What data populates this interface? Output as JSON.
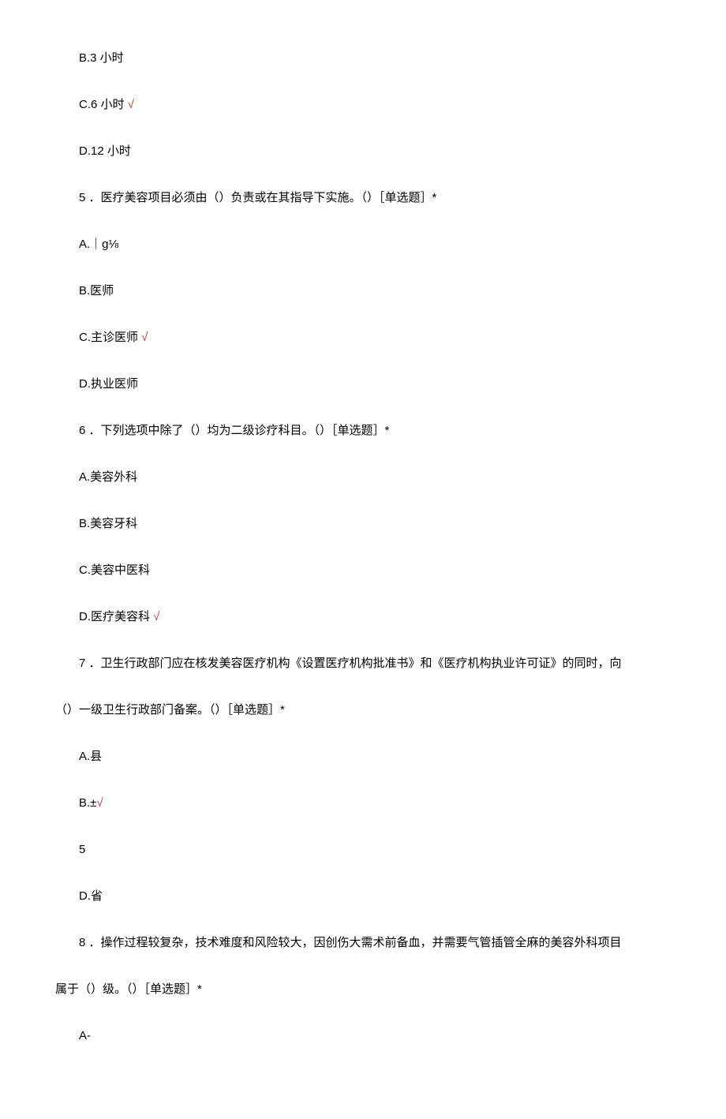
{
  "lines": {
    "l1": "B.3 小时",
    "l2": "C.6 小时 ",
    "l2_check": "√",
    "l3": "D.12 小时",
    "q5": "5 ．医疗美容项目必须由（）负责或在其指导下实施。（）［单选题］*",
    "q5a": "A.｜g⅛",
    "q5b": "B.医师",
    "q5c": "C.主诊医师 ",
    "q5c_check": "√",
    "q5d": "D.执业医师",
    "q6": "6 ．下列选项中除了（）均为二级诊疗科目。（）［单选题］*",
    "q6a": "A.美容外科",
    "q6b": "B.美容牙科",
    "q6c": "C.美容中医科",
    "q6d": "D.医疗美容科 ",
    "q6d_check": "√",
    "q7_part1": "7 ．卫生行政部门应在核发美容医疗机构《设置医疗机构批准书》和《医疗机构执业许可证》的同时，向",
    "q7_part2": "（）一级卫生行政部门备案。（）［单选题］*",
    "q7a": "A.县",
    "q7b": "B.±",
    "q7b_check": "√",
    "q7c": "5",
    "q7d": "D.省",
    "q8_part1": "8 ．操作过程较复杂，技术难度和风险较大，因创伤大需术前备血，并需要气管插管全麻的美容外科项目",
    "q8_part2": "属于（）级。（）［单选题］*",
    "q8a": "A-"
  }
}
